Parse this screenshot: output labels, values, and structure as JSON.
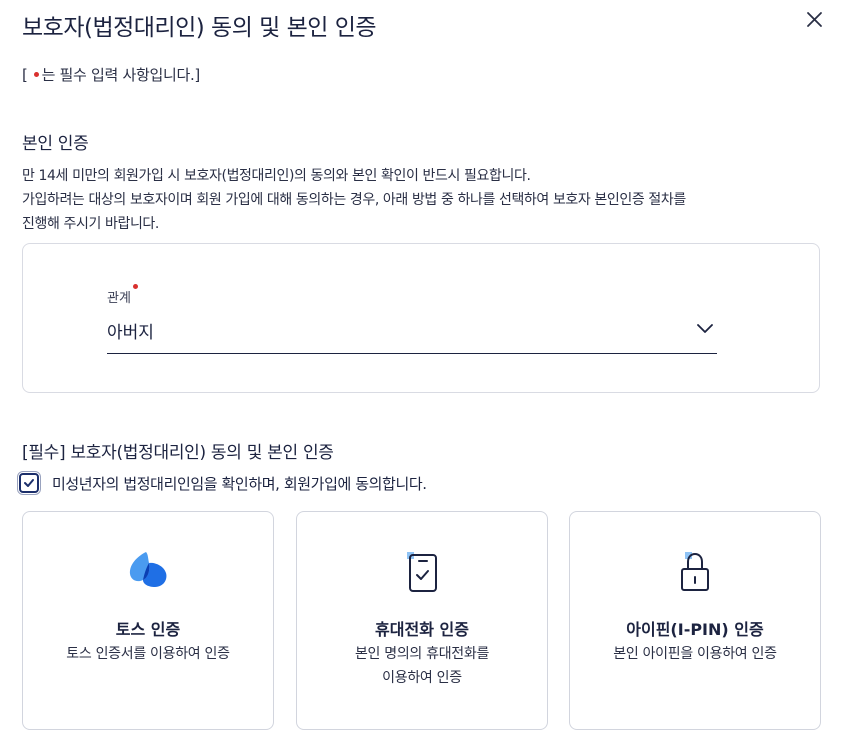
{
  "modal": {
    "title": "보호자(법정대리인) 동의 및 본인 인증",
    "close_label": "close"
  },
  "required_note": {
    "prefix": "[",
    "text": "는 필수 입력 사항입니다.]"
  },
  "identity_section": {
    "heading": "본인 인증",
    "desc_line1": "만 14세 미만의 회원가입 시 보호자(법정대리인)의 동의와 본인 확인이 반드시 필요합니다.",
    "desc_line2": "가입하려는 대상의 보호자이며 회원 가입에 대해 동의하는 경우, 아래 방법 중 하나를 선택하여 보호자 본인인증 절차를",
    "desc_line3": "진행해 주시기 바랍니다."
  },
  "relation": {
    "label": "관계",
    "value": "아버지"
  },
  "consent_section": {
    "heading": "[필수] 보호자(법정대리인) 동의 및 본인 인증",
    "checkbox_label": "미성년자의 법정대리인임을 확인하며, 회원가입에 동의합니다.",
    "checked": true
  },
  "methods": [
    {
      "title": "토스 인증",
      "sub1": "토스 인증서를 이용하여 인증",
      "sub2": "",
      "icon": "toss-logo-icon"
    },
    {
      "title": "휴대전화 인증",
      "sub1": "본인 명의의 휴대전화를",
      "sub2": "이용하여 인증",
      "icon": "phone-check-icon"
    },
    {
      "title": "아이핀(I-PIN) 인증",
      "sub1": "본인 아이핀을 이용하여 인증",
      "sub2": "",
      "icon": "lock-icon"
    }
  ],
  "colors": {
    "primary": "#1c2f6b",
    "required_dot": "#d9302e",
    "toss_blue": "#1f6fe5",
    "icon_highlight": "#8fc3f5"
  }
}
